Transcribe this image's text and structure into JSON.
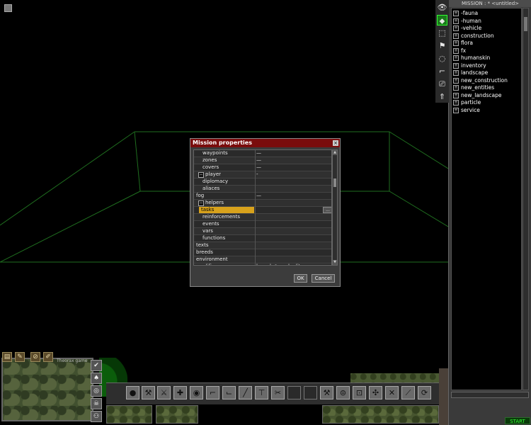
{
  "right_panel": {
    "title": "MISSION : * <untitled>",
    "tree_items": [
      {
        "label": "-fauna",
        "expander": "+"
      },
      {
        "label": "-human",
        "expander": "+"
      },
      {
        "label": "-vehicle",
        "expander": "+"
      },
      {
        "label": "construction",
        "expander": "+"
      },
      {
        "label": "flora",
        "expander": "+"
      },
      {
        "label": "fx",
        "expander": "+"
      },
      {
        "label": "humanskin",
        "expander": "+"
      },
      {
        "label": "inventory",
        "expander": "+"
      },
      {
        "label": "landscape",
        "expander": "+"
      },
      {
        "label": "new_construction",
        "expander": "+"
      },
      {
        "label": "new_entities",
        "expander": "+"
      },
      {
        "label": "new_landscape",
        "expander": "+"
      },
      {
        "label": "particle",
        "expander": "+"
      },
      {
        "label": "service",
        "expander": "+"
      }
    ],
    "tools": [
      {
        "icon": "eye-icon",
        "glyph": "👁"
      },
      {
        "icon": "entity-icon",
        "glyph": "⬥"
      },
      {
        "icon": "select-area-icon",
        "glyph": "⬚"
      },
      {
        "icon": "flag-icon",
        "glyph": "⚑"
      },
      {
        "icon": "circle-icon",
        "glyph": "◌"
      },
      {
        "icon": "step-icon",
        "glyph": "⌐"
      },
      {
        "icon": "camera-icon",
        "glyph": "⎚"
      },
      {
        "icon": "arrow-up-icon",
        "glyph": "⇑"
      }
    ],
    "start_label": "START"
  },
  "dialog": {
    "title": "Mission properties",
    "close_glyph": "×",
    "rows": [
      {
        "name": "waypoints",
        "indent": 2,
        "value": "—",
        "expander": ""
      },
      {
        "name": "zones",
        "indent": 2,
        "value": "—",
        "expander": ""
      },
      {
        "name": "covers",
        "indent": 2,
        "value": "—",
        "expander": ""
      },
      {
        "name": "player",
        "indent": 1,
        "value": "-",
        "expander": "−"
      },
      {
        "name": "diplomacy",
        "indent": 2,
        "value": "",
        "expander": ""
      },
      {
        "name": "aliaces",
        "indent": 2,
        "value": "",
        "expander": ""
      },
      {
        "name": "fog",
        "indent": 0,
        "value": "—",
        "expander": ""
      },
      {
        "name": "helpers",
        "indent": 1,
        "value": "",
        "expander": "−"
      },
      {
        "name": "tasks",
        "indent": 2,
        "value": "",
        "expander": "",
        "selected": true,
        "has_dots": true
      },
      {
        "name": "reinforcements",
        "indent": 2,
        "value": "",
        "expander": ""
      },
      {
        "name": "events",
        "indent": 2,
        "value": "",
        "expander": ""
      },
      {
        "name": "vars",
        "indent": 2,
        "value": "",
        "expander": ""
      },
      {
        "name": "functions",
        "indent": 2,
        "value": "",
        "expander": ""
      },
      {
        "name": "texts",
        "indent": 0,
        "value": "",
        "expander": ""
      },
      {
        "name": "breeds",
        "indent": 0,
        "value": "",
        "expander": ""
      },
      {
        "name": "environment",
        "indent": 0,
        "value": "",
        "expander": ""
      },
      {
        "name": "modifiers",
        "indent": 0,
        "value": "launch *.mod editor",
        "expander": ""
      }
    ],
    "dots_label": "...",
    "ok_label": "OK",
    "cancel_label": "Cancel"
  },
  "hud": {
    "map_label": "Theorax game",
    "top_icons": [
      {
        "icon": "map-icon",
        "glyph": "▤"
      },
      {
        "icon": "pencil-icon",
        "glyph": "✎"
      },
      {
        "icon": "compass-icon",
        "glyph": "⊘"
      },
      {
        "icon": "wrench-icon",
        "glyph": "✐"
      }
    ],
    "side_icons": [
      {
        "icon": "check-icon",
        "glyph": "✔"
      },
      {
        "icon": "tree-icon",
        "glyph": "♠"
      },
      {
        "icon": "radar-icon",
        "glyph": "◎"
      },
      {
        "icon": "skull-icon",
        "glyph": "☠"
      },
      {
        "icon": "people-icon",
        "glyph": "⚇"
      }
    ],
    "toolbar": [
      {
        "icon": "grenade-icon",
        "glyph": "●",
        "dark": false
      },
      {
        "icon": "shovel-icon",
        "glyph": "⚒",
        "dark": false
      },
      {
        "icon": "knife-icon",
        "glyph": "⚔",
        "dark": false
      },
      {
        "icon": "medkit-icon",
        "glyph": "✚",
        "dark": false
      },
      {
        "icon": "look-icon",
        "glyph": "◉",
        "dark": false
      },
      {
        "icon": "gun-icon",
        "glyph": "⌐",
        "dark": false
      },
      {
        "icon": "pistol-icon",
        "glyph": "⌙",
        "dark": false
      },
      {
        "icon": "rifle-icon",
        "glyph": "╱",
        "dark": false
      },
      {
        "icon": "mortar-icon",
        "glyph": "⊤",
        "dark": false
      },
      {
        "icon": "scissors-icon",
        "glyph": "✂",
        "dark": false
      },
      {
        "icon": "empty-slot-icon",
        "glyph": "",
        "dark": true
      },
      {
        "icon": "empty-slot-icon",
        "glyph": "",
        "dark": true
      },
      {
        "icon": "tool-icon",
        "glyph": "⚒",
        "dark": false
      },
      {
        "icon": "mine-icon",
        "glyph": "⊜",
        "dark": false
      },
      {
        "icon": "tank-icon",
        "glyph": "⊡",
        "dark": false
      },
      {
        "icon": "repair-icon",
        "glyph": "✣",
        "dark": false
      },
      {
        "icon": "cross-tools-icon",
        "glyph": "✕",
        "dark": false
      },
      {
        "icon": "blade-icon",
        "glyph": "⟋",
        "dark": false
      },
      {
        "icon": "refresh-icon",
        "glyph": "⟳",
        "dark": false
      }
    ]
  }
}
